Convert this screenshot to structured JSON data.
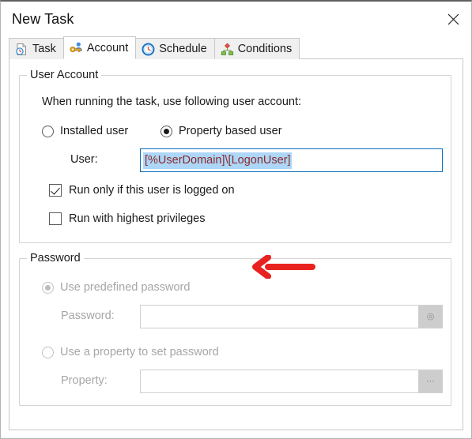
{
  "window": {
    "title": "New Task",
    "close_label": "✕",
    "close_icon": "close-icon"
  },
  "tabs": [
    {
      "label": "Task",
      "icon": "document-clock-icon",
      "active": false
    },
    {
      "label": "Account",
      "icon": "key-user-icon",
      "active": true
    },
    {
      "label": "Schedule",
      "icon": "clock-icon",
      "active": false
    },
    {
      "label": "Conditions",
      "icon": "hierarchy-icon",
      "active": false
    }
  ],
  "user_account": {
    "group_title": "User Account",
    "description": "When running the task, use following user account:",
    "radios": [
      {
        "label": "Installed user",
        "checked": false
      },
      {
        "label": "Property based user",
        "checked": true
      }
    ],
    "user_label": "User:",
    "user_value": "[%UserDomain]\\[LogonUser]",
    "checkboxes": [
      {
        "label": "Run only if this user is logged on",
        "checked": true
      },
      {
        "label": "Run with highest privileges",
        "checked": false
      }
    ]
  },
  "password": {
    "group_title": "Password",
    "radios": [
      {
        "label": "Use predefined password",
        "checked": true,
        "disabled": true
      },
      {
        "label": "Use a property to set password",
        "checked": false,
        "disabled": true
      }
    ],
    "password_label": "Password:",
    "password_value": "",
    "password_button_glyph": "◎",
    "password_button_icon": "eye-icon",
    "property_label": "Property:",
    "property_value": "",
    "property_button_glyph": "⋯",
    "property_button_icon": "ellipsis-icon"
  },
  "annotation": {
    "name": "red-arrow-annotation",
    "color": "#e8231f",
    "direction": "left"
  },
  "colors": {
    "focus_border": "#0a6cba",
    "selection_bg": "#add6f7",
    "selection_text": "#8a2b2b",
    "disabled_text": "#a6a6a6",
    "group_border": "#d4d4d4",
    "annotation_red": "#e8231f"
  }
}
